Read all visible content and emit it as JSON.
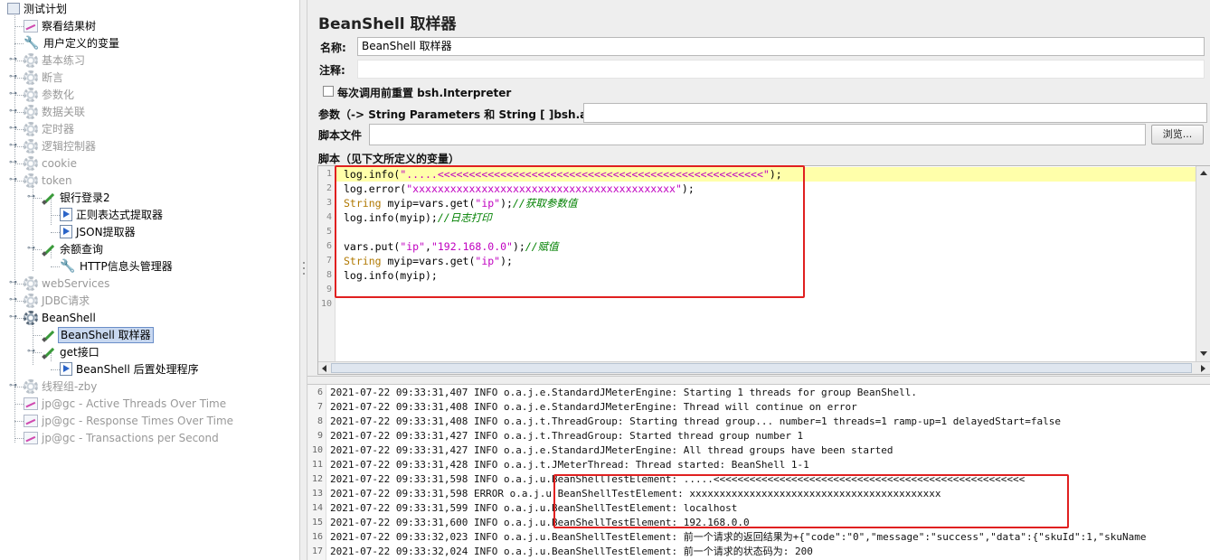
{
  "tree": {
    "items": [
      {
        "label": "测试计划",
        "icon": "test-plan-icon",
        "disabled": false
      },
      {
        "label": "察看结果树",
        "icon": "chart-icon",
        "disabled": false
      },
      {
        "label": "用户定义的变量",
        "icon": "wrench-icon",
        "disabled": false
      },
      {
        "label": "基本练习",
        "icon": "gear-icon",
        "disabled": true
      },
      {
        "label": "断言",
        "icon": "gear-icon",
        "disabled": true
      },
      {
        "label": "参数化",
        "icon": "gear-icon",
        "disabled": true
      },
      {
        "label": "数据关联",
        "icon": "gear-icon",
        "disabled": true
      },
      {
        "label": "定时器",
        "icon": "gear-icon",
        "disabled": true
      },
      {
        "label": "逻辑控制器",
        "icon": "gear-icon",
        "disabled": true
      },
      {
        "label": "cookie",
        "icon": "gear-icon",
        "disabled": true
      },
      {
        "label": "token",
        "icon": "gear-icon",
        "disabled": true
      },
      {
        "label": "银行登录2",
        "icon": "pipette-icon",
        "disabled": false
      },
      {
        "label": "正则表达式提取器",
        "icon": "postprocessor-icon",
        "disabled": false
      },
      {
        "label": "JSON提取器",
        "icon": "postprocessor-icon",
        "disabled": false
      },
      {
        "label": "余额查询",
        "icon": "pipette-icon",
        "disabled": false
      },
      {
        "label": "HTTP信息头管理器",
        "icon": "wrench-icon",
        "disabled": false
      },
      {
        "label": "webServices",
        "icon": "gear-icon",
        "disabled": true
      },
      {
        "label": "JDBC请求",
        "icon": "gear-icon",
        "disabled": true
      },
      {
        "label": "BeanShell",
        "icon": "gear-icon",
        "disabled": false
      },
      {
        "label": "BeanShell 取样器",
        "icon": "pipette-icon",
        "disabled": false,
        "selected": true
      },
      {
        "label": "get接口",
        "icon": "pipette-icon",
        "disabled": false
      },
      {
        "label": "BeanShell 后置处理程序",
        "icon": "postprocessor-icon",
        "disabled": false
      },
      {
        "label": "线程组-zby",
        "icon": "gear-icon",
        "disabled": true
      },
      {
        "label": "jp@gc - Active Threads Over Time",
        "icon": "chart-icon",
        "disabled": true
      },
      {
        "label": "jp@gc - Response Times Over Time",
        "icon": "chart-icon",
        "disabled": true
      },
      {
        "label": "jp@gc - Transactions per Second",
        "icon": "chart-icon",
        "disabled": true
      }
    ]
  },
  "panel": {
    "title": "BeanShell 取样器",
    "name_label": "名称:",
    "name_value": "BeanShell 取样器",
    "comment_label": "注释:",
    "comment_value": "",
    "reset_label": "每次调用前重置 bsh.Interpreter",
    "params_label": "参数（-> String Parameters 和 String [ ]bsh.args）",
    "params_value": "",
    "script_file_label": "脚本文件",
    "script_file_value": "",
    "browse_label": "浏览...",
    "script_label": "脚本（见下文所定义的变量）"
  },
  "script": {
    "lines": [
      [
        [
          "log.info(",
          "plain"
        ],
        [
          "\".....<<<<<<<<<<<<<<<<<<<<<<<<<<<<<<<<<<<<<<<<<<<<<<<<<<<<\"",
          "str"
        ],
        [
          ");",
          "plain"
        ]
      ],
      [
        [
          "log.error(",
          "plain"
        ],
        [
          "\"xxxxxxxxxxxxxxxxxxxxxxxxxxxxxxxxxxxxxxxxxx\"",
          "str"
        ],
        [
          ");",
          "plain"
        ]
      ],
      [
        [
          "String",
          "kw"
        ],
        [
          " myip=vars.get(",
          "plain"
        ],
        [
          "\"ip\"",
          "str"
        ],
        [
          ");",
          "plain"
        ],
        [
          "//获取参数值",
          "com"
        ]
      ],
      [
        [
          "log.info(myip);",
          "plain"
        ],
        [
          "//日志打印",
          "com"
        ]
      ],
      [
        [
          "",
          "plain"
        ]
      ],
      [
        [
          "vars.put(",
          "plain"
        ],
        [
          "\"ip\"",
          "str"
        ],
        [
          ",",
          "plain"
        ],
        [
          "\"192.168.0.0\"",
          "str"
        ],
        [
          ");",
          "plain"
        ],
        [
          "//赋值",
          "com"
        ]
      ],
      [
        [
          "String",
          "kw"
        ],
        [
          " myip=vars.get(",
          "plain"
        ],
        [
          "\"ip\"",
          "str"
        ],
        [
          ");",
          "plain"
        ]
      ],
      [
        [
          "log.info(myip);",
          "plain"
        ]
      ],
      [
        [
          "",
          "plain"
        ]
      ],
      [
        [
          "",
          "plain"
        ]
      ]
    ]
  },
  "log": {
    "lines": [
      {
        "n": "6",
        "text": "2021-07-22 09:33:31,407 INFO o.a.j.e.StandardJMeterEngine: Starting 1 threads for group BeanShell."
      },
      {
        "n": "7",
        "text": "2021-07-22 09:33:31,408 INFO o.a.j.e.StandardJMeterEngine: Thread will continue on error"
      },
      {
        "n": "8",
        "text": "2021-07-22 09:33:31,408 INFO o.a.j.t.ThreadGroup: Starting thread group... number=1 threads=1 ramp-up=1 delayedStart=false"
      },
      {
        "n": "9",
        "text": "2021-07-22 09:33:31,427 INFO o.a.j.t.ThreadGroup: Started thread group number 1"
      },
      {
        "n": "10",
        "text": "2021-07-22 09:33:31,427 INFO o.a.j.e.StandardJMeterEngine: All thread groups have been started"
      },
      {
        "n": "11",
        "text": "2021-07-22 09:33:31,428 INFO o.a.j.t.JMeterThread: Thread started: BeanShell 1-1"
      },
      {
        "n": "12",
        "text": "2021-07-22 09:33:31,598 INFO o.a.j.u.BeanShellTestElement: .....<<<<<<<<<<<<<<<<<<<<<<<<<<<<<<<<<<<<<<<<<<<<<<<<<<<<"
      },
      {
        "n": "13",
        "text": "2021-07-22 09:33:31,598 ERROR o.a.j.u.BeanShellTestElement: xxxxxxxxxxxxxxxxxxxxxxxxxxxxxxxxxxxxxxxxxx"
      },
      {
        "n": "14",
        "text": "2021-07-22 09:33:31,599 INFO o.a.j.u.BeanShellTestElement: localhost"
      },
      {
        "n": "15",
        "text": "2021-07-22 09:33:31,600 INFO o.a.j.u.BeanShellTestElement: 192.168.0.0"
      },
      {
        "n": "16",
        "text": "2021-07-22 09:33:32,023 INFO o.a.j.u.BeanShellTestElement: 前一个请求的返回结果为+{\"code\":\"0\",\"message\":\"success\",\"data\":{\"skuId\":1,\"skuName"
      },
      {
        "n": "17",
        "text": "2021-07-22 09:33:32,024 INFO o.a.j.u.BeanShellTestElement: 前一个请求的状态码为: 200"
      }
    ]
  },
  "colors": {
    "highlight_box": "#e02020",
    "current_line": "#ffffaa",
    "string": "#c000c0",
    "keyword": "#b07800",
    "comment": "#008000"
  }
}
